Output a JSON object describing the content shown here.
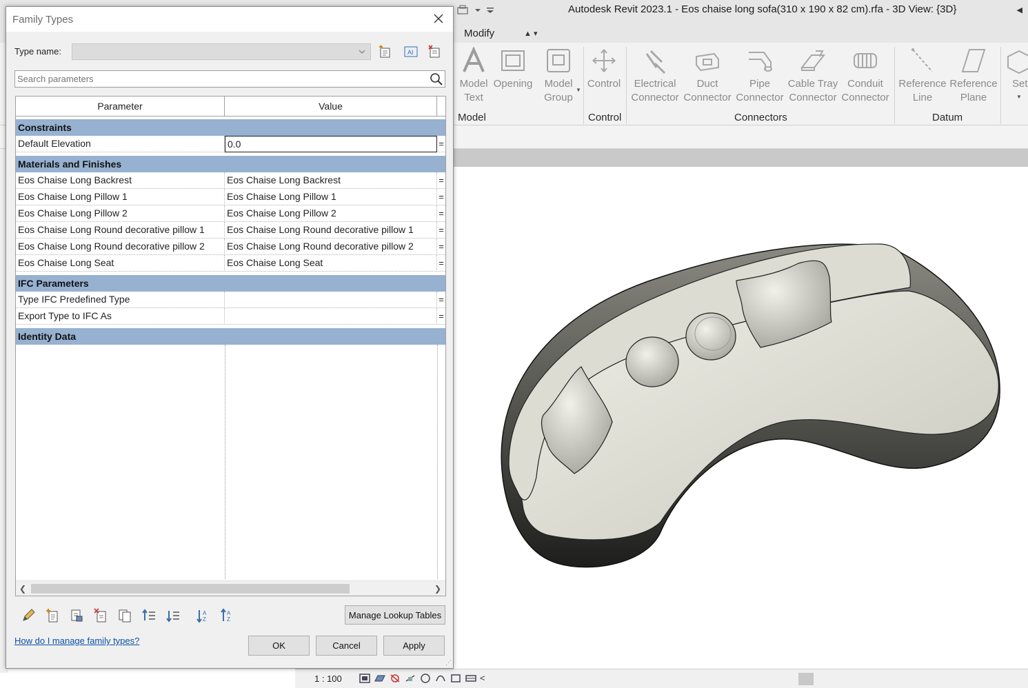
{
  "app": {
    "title": "Autodesk Revit 2023.1 - Eos chaise long sofa(310 x 190 x 82 cm).rfa - 3D View: {3D}",
    "tabs": [
      "Modify"
    ],
    "ribbon": {
      "buttons": [
        {
          "label": "Model",
          "label2": "Text",
          "icon": "model-text-icon"
        },
        {
          "label": "Opening",
          "label2": "",
          "icon": "opening-icon"
        },
        {
          "label": "Model",
          "label2": "Group",
          "icon": "model-group-icon"
        },
        {
          "label": "Control",
          "label2": "",
          "icon": "control-icon"
        },
        {
          "label": "Electrical",
          "label2": "Connector",
          "icon": "electrical-connector-icon"
        },
        {
          "label": "Duct",
          "label2": "Connector",
          "icon": "duct-connector-icon"
        },
        {
          "label": "Pipe",
          "label2": "Connector",
          "icon": "pipe-connector-icon"
        },
        {
          "label": "Cable Tray",
          "label2": "Connector",
          "icon": "cable-tray-connector-icon"
        },
        {
          "label": "Conduit",
          "label2": "Connector",
          "icon": "conduit-connector-icon"
        },
        {
          "label": "Reference",
          "label2": "Line",
          "icon": "reference-line-icon"
        },
        {
          "label": "Reference",
          "label2": "Plane",
          "icon": "reference-plane-icon"
        },
        {
          "label": "Set",
          "label2": "",
          "icon": "set-icon"
        }
      ],
      "panels": [
        "Model",
        "Control",
        "Connectors",
        "Datum"
      ]
    },
    "status": {
      "scale": "1 : 100"
    }
  },
  "dialog": {
    "title": "Family Types",
    "type_name_label": "Type name:",
    "type_name_value": "",
    "search_placeholder": "Search parameters",
    "columns": [
      "Parameter",
      "Value"
    ],
    "groups": [
      {
        "name": "Constraints",
        "rows": [
          {
            "param": "Default Elevation",
            "value": "0.0",
            "formula": "="
          }
        ]
      },
      {
        "name": "Materials and Finishes",
        "rows": [
          {
            "param": "Eos Chaise Long Backrest",
            "value": "Eos Chaise Long Backrest",
            "formula": "="
          },
          {
            "param": "Eos Chaise Long Pillow 1",
            "value": "Eos Chaise Long Pillow 1",
            "formula": "="
          },
          {
            "param": "Eos Chaise Long Pillow 2",
            "value": "Eos Chaise Long Pillow 2",
            "formula": "="
          },
          {
            "param": "Eos Chaise Long Round decorative pillow 1",
            "value": "Eos Chaise Long Round decorative pillow 1",
            "formula": "="
          },
          {
            "param": "Eos Chaise Long Round decorative pillow 2",
            "value": "Eos Chaise Long Round decorative pillow 2",
            "formula": "="
          },
          {
            "param": "Eos Chaise Long Seat",
            "value": "Eos Chaise Long Seat",
            "formula": "="
          }
        ]
      },
      {
        "name": "IFC Parameters",
        "rows": [
          {
            "param": "Type IFC Predefined Type",
            "value": "",
            "formula": "="
          },
          {
            "param": "Export Type to IFC As",
            "value": "",
            "formula": "="
          }
        ]
      },
      {
        "name": "Identity Data",
        "rows": []
      }
    ],
    "manage_lookup_label": "Manage Lookup Tables",
    "help_link": "How do I manage family types?",
    "ok_label": "OK",
    "cancel_label": "Cancel",
    "apply_label": "Apply",
    "tool_icons": [
      "pencil-icon",
      "new-parameter-icon",
      "modify-parameter-icon",
      "delete-parameter-icon",
      "copy-parameter-icon",
      "move-up-icon",
      "move-down-icon",
      "sort-ascending-icon",
      "sort-descending-icon"
    ]
  },
  "colors": {
    "group_header": "#97b1d1",
    "sofa_fabric": "#d6d6cc",
    "link": "#0b4fa6"
  }
}
